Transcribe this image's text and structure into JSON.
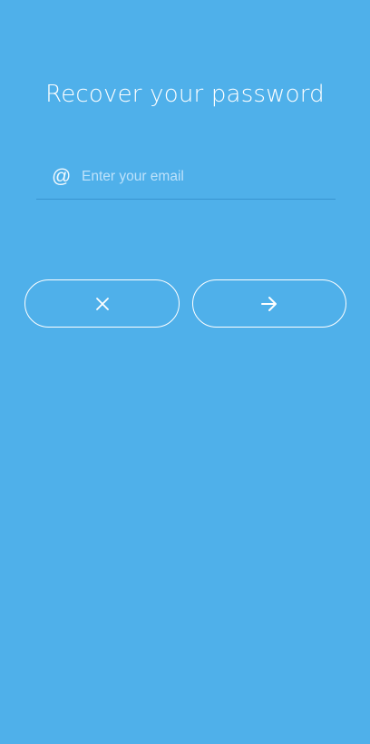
{
  "page": {
    "title": "Recover your password",
    "background_color": "#4FB0EA",
    "accent_color": "#FFFFFF"
  },
  "email_field": {
    "icon": "at-icon",
    "icon_glyph": "@",
    "placeholder": "Enter your email",
    "value": ""
  },
  "buttons": {
    "cancel": {
      "icon": "close-icon"
    },
    "submit": {
      "icon": "arrow-right-icon"
    }
  }
}
